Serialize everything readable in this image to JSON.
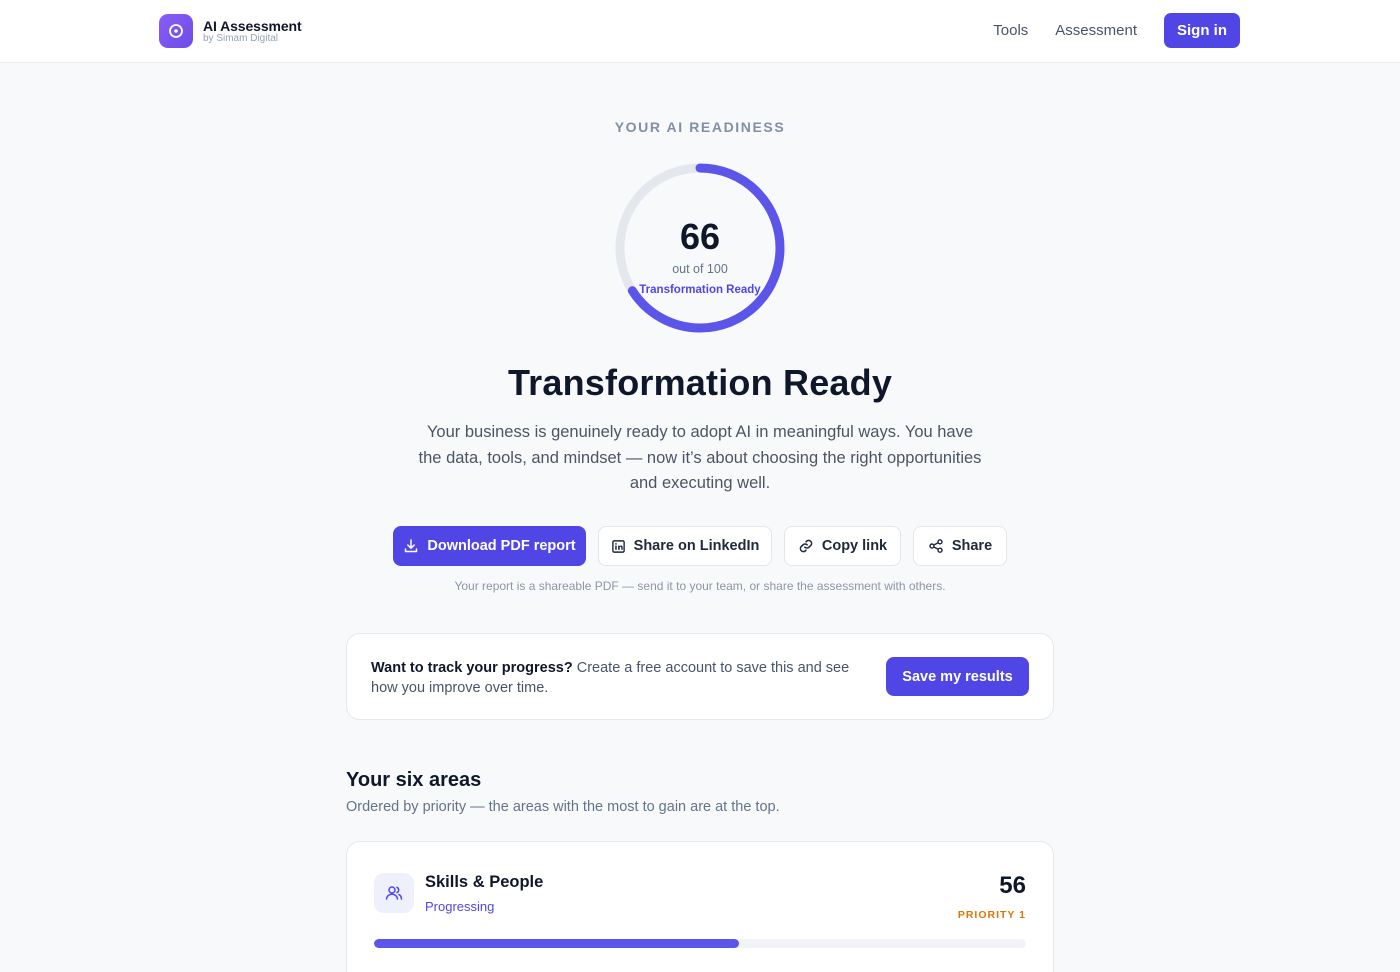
{
  "brand": {
    "name": "AI Assessment",
    "subtitle": "by Simam Digital"
  },
  "nav": {
    "tools": "Tools",
    "assessment": "Assessment",
    "sign_in": "Sign in"
  },
  "hero": {
    "eyebrow": "YOUR AI READINESS",
    "score": 66,
    "score_max_label": "out of 100",
    "score_level": "Transformation Ready",
    "headline": "Transformation Ready",
    "description": "Your business is genuinely ready to adopt AI in meaningful ways. You have the data, tools, and mindset — now it’s about choosing the right opportunities and executing well."
  },
  "actions": {
    "download": "Download PDF report",
    "linkedin": "Share on LinkedIn",
    "copy": "Copy link",
    "share": "Share",
    "note": "Your report is a shareable PDF — send it to your team, or share the assessment with others."
  },
  "save_card": {
    "bold": "Want to track your progress?",
    "text": " Create a free account to save this and see how you improve over time.",
    "button": "Save my results"
  },
  "areas": {
    "title": "Your six areas",
    "subtitle": "Ordered by priority — the areas with the most to gain are at the top.",
    "items": [
      {
        "name": "Skills & People",
        "status": "Progressing",
        "score": "56",
        "priority": "PRIORITY 1",
        "progress_fraction": 0.56,
        "icon": "people-icon"
      }
    ]
  },
  "colors": {
    "accent": "#4f46e5",
    "ring_track": "#e5e7ee",
    "priority": "#d97706",
    "background": "#f8f9fb"
  }
}
